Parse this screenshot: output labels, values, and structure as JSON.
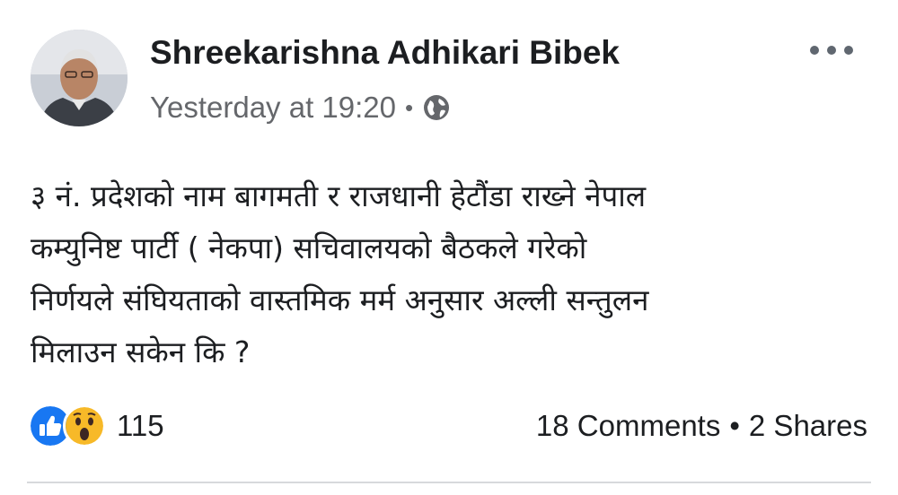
{
  "post": {
    "author": "Shreekarishna Adhikari Bibek",
    "timestamp": "Yesterday at 19:20",
    "privacy_icon": "globe-icon",
    "more_icon": "more-options-icon",
    "text_lines": [
      "३ नं. प्रदेशको नाम बागमती र राजधानी हेटौंडा राख्ने नेपाल",
      "कम्युनिष्ट पार्टी ( नेकपा) सचिवालयको बैठकले गरेको",
      "निर्णयले संघियताको वास्तमिक मर्म अनुसार अल्ली सन्तुलन",
      "मिलाउन सकेन कि ?"
    ]
  },
  "reactions": {
    "icons": [
      "like-icon",
      "wow-icon"
    ],
    "count": "115",
    "like_color": "#1877f2",
    "wow_color": "#f7b928"
  },
  "engagement": {
    "comments": "18 Comments",
    "separator": "•",
    "shares": "2 Shares"
  },
  "meta": {
    "separator": "•"
  }
}
